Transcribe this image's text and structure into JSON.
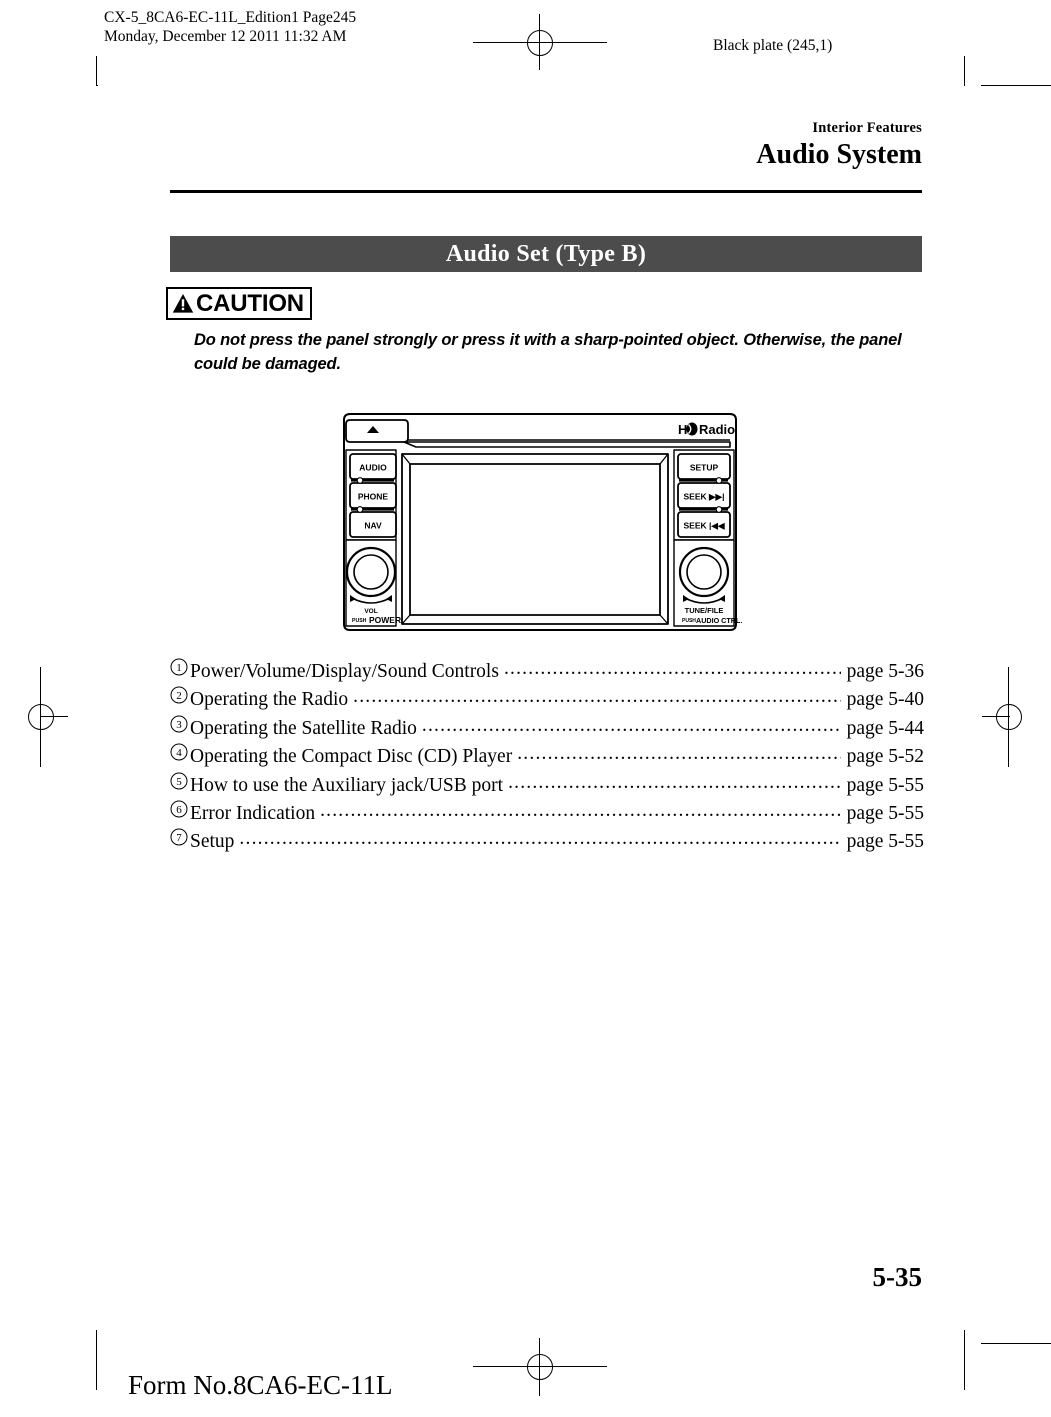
{
  "print_marks": {
    "slug_line1": "CX-5_8CA6-EC-11L_Edition1  Page245",
    "slug_line2": "Monday, December 12 2011 11:32 AM",
    "black_plate": "Black plate (245,1)",
    "form_no": "Form No.8CA6-EC-11L"
  },
  "running_head": {
    "section": "Interior Features",
    "chapter": "Audio System"
  },
  "banner": {
    "title": "Audio Set (Type B)"
  },
  "caution": {
    "icon": "warning-triangle-icon",
    "label": "CAUTION",
    "body": "Do not press the panel strongly or press it with a sharp-pointed object. Otherwise, the panel could be damaged."
  },
  "audio_unit": {
    "brand_logo": "HD Radio",
    "eject_icon": "eject-icon",
    "left_buttons": [
      "AUDIO",
      "PHONE",
      "NAV"
    ],
    "right_buttons": [
      "SETUP",
      "SEEK ▶▶|",
      "SEEK |◀◀"
    ],
    "left_knob": {
      "line1": "VOL",
      "line2_small": "PUSH",
      "line2": "POWER"
    },
    "right_knob": {
      "line1": "TUNE/FILE",
      "line2_small": "PUSH",
      "line2": "AUDIO CTRL."
    }
  },
  "toc": {
    "items": [
      {
        "num": "1",
        "label": "Power/Volume/Display/Sound Controls",
        "page": "page 5-36"
      },
      {
        "num": "2",
        "label": "Operating the Radio",
        "page": "page 5-40"
      },
      {
        "num": "3",
        "label": "Operating the Satellite Radio",
        "page": "page 5-44"
      },
      {
        "num": "4",
        "label": "Operating the Compact Disc (CD) Player",
        "page": "page 5-52"
      },
      {
        "num": "5",
        "label": "How to use the Auxiliary jack/USB port",
        "page": "page 5-55"
      },
      {
        "num": "6",
        "label": "Error Indication",
        "page": "page 5-55"
      },
      {
        "num": "7",
        "label": "Setup",
        "page": "page 5-55"
      }
    ],
    "leader": "........................................................................................................................................"
  },
  "folio": {
    "page_number": "5-35"
  }
}
